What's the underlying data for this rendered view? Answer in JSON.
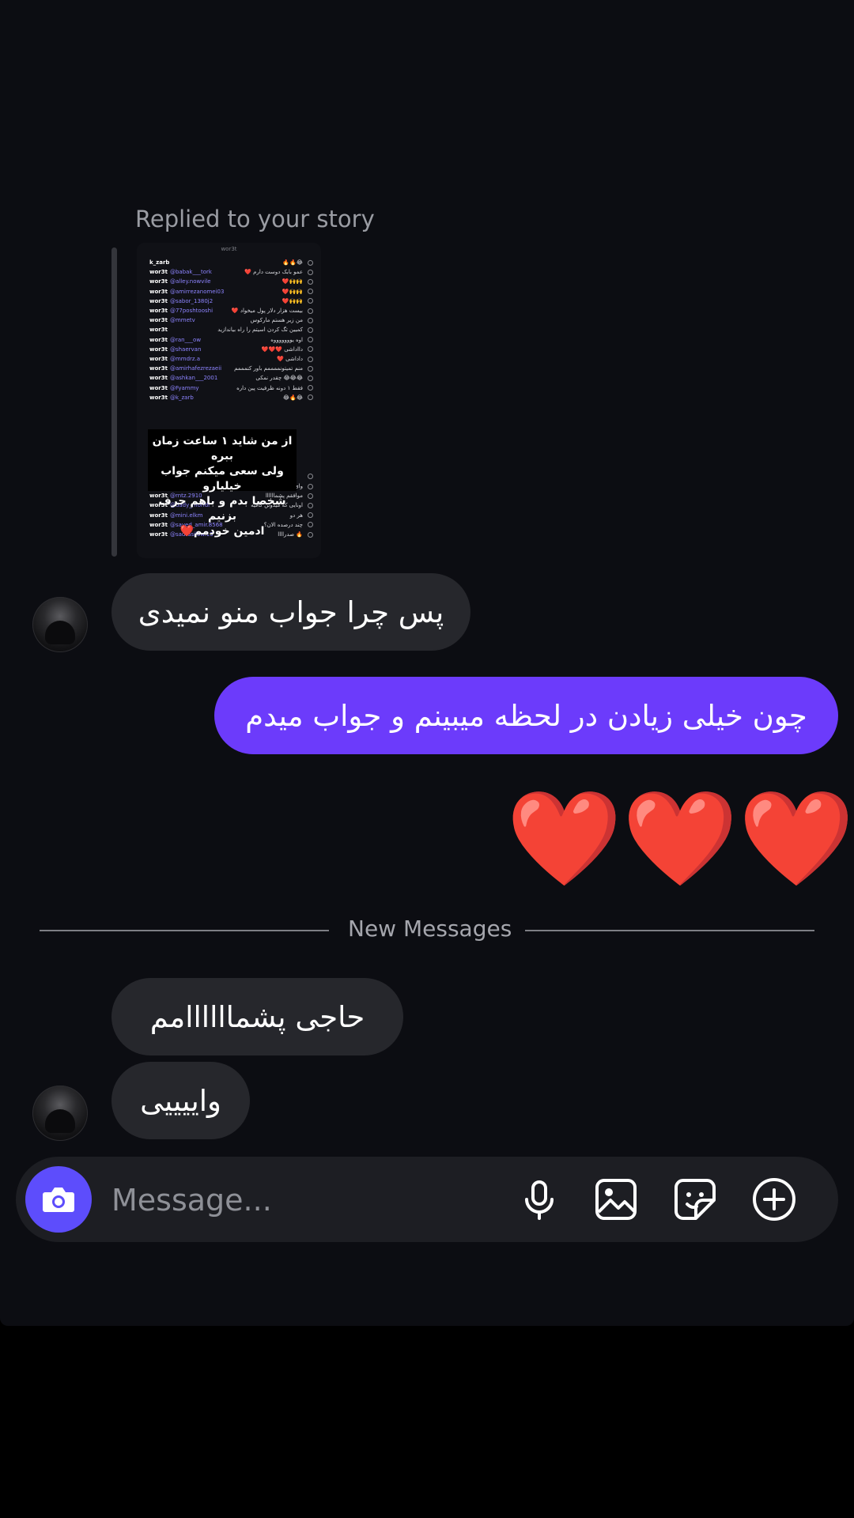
{
  "thread": {
    "replied_label": "Replied to your story",
    "story_preview": {
      "header": "wor3t",
      "rows": [
        {
          "user": "k_zarb",
          "text": "😂🔥🔥"
        },
        {
          "user": "wor3t",
          "mention": "@babak___tork",
          "text": "عمو بابک دوست دارم ❤️"
        },
        {
          "user": "wor3t",
          "mention": "@alley.nowvile",
          "text": "🙌🙌❤️"
        },
        {
          "user": "wor3t",
          "mention": "@amirrezanomei03",
          "text": "🙌🙌❤️"
        },
        {
          "user": "wor3t",
          "mention": "@sabor_1380j2",
          "text": "🙌🙌❤️"
        },
        {
          "user": "wor3t",
          "mention": "@77poshtooshi",
          "text": "بیست هزار دلار پول میخواد ❤️"
        },
        {
          "user": "wor3t",
          "mention": "@mmetv",
          "text": "من زیر هستم مارکوس"
        },
        {
          "user": "wor3t",
          "mention": "",
          "text": "کمیین تگ کردن اسیتم را راه بیاندازید"
        },
        {
          "user": "wor3t",
          "mention": "@ran___ow",
          "text": "اوه یوووووووه"
        },
        {
          "user": "wor3t",
          "mention": "@shaervan",
          "text": "دااداشی ❤️❤️❤️"
        },
        {
          "user": "wor3t",
          "mention": "@mmdrz.a",
          "text": "داداشی ❤️"
        },
        {
          "user": "wor3t",
          "mention": "@amirhafezrezaeii",
          "text": "منم تمیتونممممم باور کنمممم"
        },
        {
          "user": "wor3t",
          "mention": "@ashkan___2001",
          "text": "😂😂😂 چقدر نمکی"
        },
        {
          "user": "wor3t",
          "mention": "@Fyammy",
          "text": "فقط ۱ دونه ظرفیت پین داره"
        },
        {
          "user": "wor3t",
          "mention": "@k_zarb",
          "text": "😂🔥😂"
        },
        {
          "user": "wor3t",
          "mention": "@sedat",
          "text": ""
        },
        {
          "user": "wor3t",
          "mention": "@bhi.artworks",
          "text": "وای خدای من چقدر با مزه"
        },
        {
          "user": "wor3t",
          "mention": "@rntz.2910",
          "text": "موافقم پشماااااا"
        },
        {
          "user": "wor3t",
          "mention": "@dady_moridi",
          "text": "اونایی که میدونن گافیه"
        },
        {
          "user": "wor3t",
          "mention": "@mini.elkm",
          "text": "هر دو"
        },
        {
          "user": "wor3t",
          "mention": "@sayed_amir.8568",
          "text": "چند درصده الان؟"
        },
        {
          "user": "wor3t",
          "mention": "@sadrasilow.13",
          "text": "🔥 صدراااا"
        }
      ],
      "overlay_lines": [
        "از من شاید ۱ ساعت زمان ببره",
        "ولی سعی میکنم جواب خیلیارو",
        "شخصا بدم و باهم حرف بزنیم",
        "ادمین خودمم❤️"
      ]
    },
    "messages": {
      "m1": "پس چرا جواب منو نمیدی",
      "m2": "چون خیلی زیادن در لحظه میبینم و جواب میدم",
      "hearts": "❤️❤️❤️",
      "m3": "حاجی پشماااااامم",
      "m4": "واییییی"
    },
    "new_messages_label": "New Messages"
  },
  "composer": {
    "placeholder": "Message...",
    "icons": [
      "camera-icon",
      "microphone-icon",
      "gallery-icon",
      "sticker-icon",
      "plus-icon"
    ]
  },
  "colors": {
    "background": "#0c0d12",
    "incoming_bubble": "#26272c",
    "outgoing_bubble": "#6c3bfb",
    "camera_button": "#5d4dfc"
  }
}
